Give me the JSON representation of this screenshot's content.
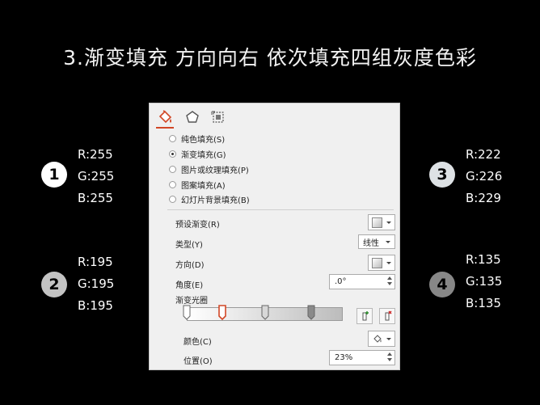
{
  "slide": {
    "title": "3.渐变填充 方向向右 依次填充四组灰度色彩"
  },
  "groups": [
    {
      "number": "1",
      "r": "R:255",
      "g": "G:255",
      "b": "B:255",
      "badge_bg": "#ffffff",
      "badge_fg": "#000000"
    },
    {
      "number": "2",
      "r": "R:195",
      "g": "G:195",
      "b": "B:195",
      "badge_bg": "#c3c3c3",
      "badge_fg": "#000000"
    },
    {
      "number": "3",
      "r": "R:222",
      "g": "G:226",
      "b": "B:229",
      "badge_bg": "#dee2e5",
      "badge_fg": "#000000"
    },
    {
      "number": "4",
      "r": "R:135",
      "g": "G:135",
      "b": "B:135",
      "badge_bg": "#878787",
      "badge_fg": "#000000"
    }
  ],
  "panel": {
    "tabs": [
      {
        "icon": "fill-bucket-icon",
        "active": true
      },
      {
        "icon": "pentagon-effects-icon",
        "active": false
      },
      {
        "icon": "size-layout-icon",
        "active": false
      }
    ],
    "accent": "#d24726",
    "fill_options": [
      {
        "label": "纯色填充(S)",
        "checked": false
      },
      {
        "label": "渐变填充(G)",
        "checked": true
      },
      {
        "label": "图片或纹理填充(P)",
        "checked": false
      },
      {
        "label": "图案填充(A)",
        "checked": false
      },
      {
        "label": "幻灯片背景填充(B)",
        "checked": false
      }
    ],
    "preset_label": "预设渐变(R)",
    "type_label": "类型(Y)",
    "type_value": "线性",
    "direction_label": "方向(D)",
    "angle_label": "角度(E)",
    "angle_value": ".0°",
    "stops_label": "渐变光圈",
    "gradient_stops": [
      0,
      0.23,
      0.5,
      0.8
    ],
    "selected_stop": 1,
    "color_label": "颜色(C)",
    "position_label": "位置(O)",
    "position_value": "23%"
  }
}
